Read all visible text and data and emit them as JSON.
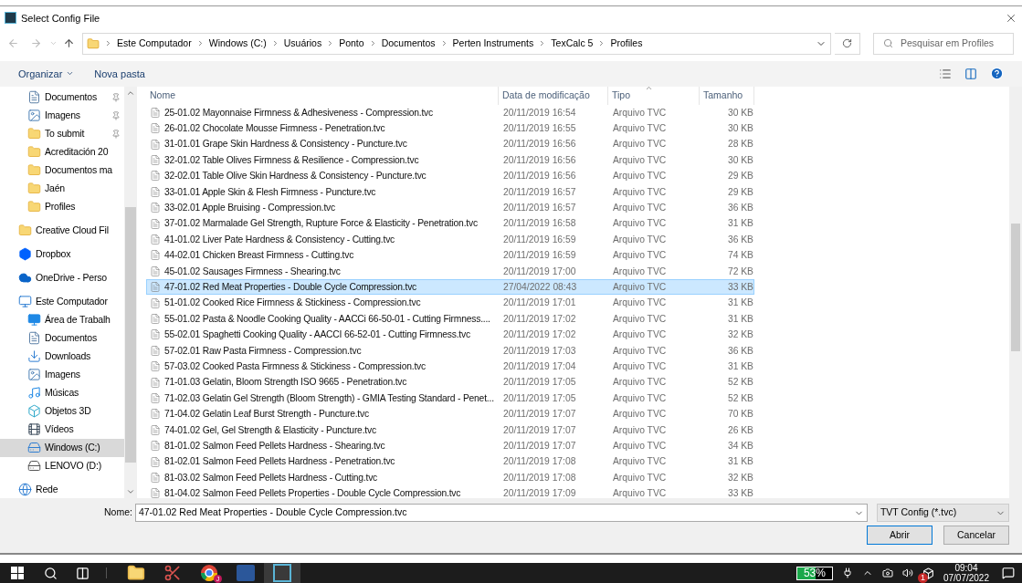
{
  "window": {
    "title": "Select Config File"
  },
  "breadcrumbs": [
    "Este Computador",
    "Windows (C:)",
    "Usuários",
    "Ponto",
    "Documentos",
    "Perten Instruments",
    "TexCalc 5",
    "Profiles"
  ],
  "search": {
    "placeholder": "Pesquisar em Profiles"
  },
  "toolbar": {
    "organize": "Organizar",
    "new_folder": "Nova pasta"
  },
  "sidebar": {
    "pinned_group": [
      {
        "label": "Documentos",
        "kind": "doc",
        "pinned": true,
        "selected": false
      },
      {
        "label": "Imagens",
        "kind": "image",
        "pinned": true,
        "selected": false
      },
      {
        "label": "To submit",
        "kind": "folder",
        "pinned": true,
        "selected": false
      },
      {
        "label": "Acreditación 20",
        "kind": "folder",
        "pinned": false,
        "selected": false
      },
      {
        "label": "Documentos ma",
        "kind": "folder",
        "pinned": false,
        "selected": false
      },
      {
        "label": "Jaén",
        "kind": "folder",
        "pinned": false,
        "selected": false
      },
      {
        "label": "Profiles",
        "kind": "folder",
        "pinned": false,
        "selected": false
      }
    ],
    "items": [
      {
        "label": "Creative Cloud Fil",
        "kind": "cc",
        "selected": false
      },
      {
        "label": "Dropbox",
        "kind": "dropbox",
        "selected": false
      },
      {
        "label": "OneDrive - Perso",
        "kind": "onedrive",
        "selected": false
      },
      {
        "label": "Este Computador",
        "kind": "computer",
        "selected": false,
        "children": [
          {
            "label": "Área de Trabalh",
            "kind": "desktop",
            "selected": false
          },
          {
            "label": "Documentos",
            "kind": "doc",
            "selected": false
          },
          {
            "label": "Downloads",
            "kind": "download",
            "selected": false
          },
          {
            "label": "Imagens",
            "kind": "image",
            "selected": false
          },
          {
            "label": "Músicas",
            "kind": "music",
            "selected": false
          },
          {
            "label": "Objetos 3D",
            "kind": "cube",
            "selected": false
          },
          {
            "label": "Vídeos",
            "kind": "video",
            "selected": false
          },
          {
            "label": "Windows (C:)",
            "kind": "windrive",
            "selected": true
          },
          {
            "label": "LENOVO (D:)",
            "kind": "drive",
            "selected": false
          }
        ]
      },
      {
        "label": "Rede",
        "kind": "network",
        "selected": false
      }
    ]
  },
  "table": {
    "columns": [
      "Nome",
      "Data de modificação",
      "Tipo",
      "Tamanho"
    ],
    "rows": [
      {
        "name": "25-01.02 Mayonnaise Firmness & Adhesiveness - Compression.tvc",
        "date": "20/11/2019 16:54",
        "type": "Arquivo TVC",
        "size": "30 KB",
        "selected": false
      },
      {
        "name": "26-01.02 Chocolate Mousse Firmness - Penetration.tvc",
        "date": "20/11/2019 16:55",
        "type": "Arquivo TVC",
        "size": "30 KB",
        "selected": false
      },
      {
        "name": "31-01.01 Grape Skin Hardness & Consistency - Puncture.tvc",
        "date": "20/11/2019 16:56",
        "type": "Arquivo TVC",
        "size": "28 KB",
        "selected": false
      },
      {
        "name": "32-01.02 Table Olives Firmness & Resilience - Compression.tvc",
        "date": "20/11/2019 16:56",
        "type": "Arquivo TVC",
        "size": "30 KB",
        "selected": false
      },
      {
        "name": "32-02.01 Table Olive Skin Hardness & Consistency - Puncture.tvc",
        "date": "20/11/2019 16:56",
        "type": "Arquivo TVC",
        "size": "29 KB",
        "selected": false
      },
      {
        "name": "33-01.01 Apple Skin & Flesh Firmness - Puncture.tvc",
        "date": "20/11/2019 16:57",
        "type": "Arquivo TVC",
        "size": "29 KB",
        "selected": false
      },
      {
        "name": "33-02.01 Apple Bruising - Compression.tvc",
        "date": "20/11/2019 16:57",
        "type": "Arquivo TVC",
        "size": "36 KB",
        "selected": false
      },
      {
        "name": "37-01.02 Marmalade Gel Strength, Rupture Force & Elasticity - Penetration.tvc",
        "date": "20/11/2019 16:58",
        "type": "Arquivo TVC",
        "size": "31 KB",
        "selected": false
      },
      {
        "name": "41-01.02 Liver Pate Hardness & Consistency - Cutting.tvc",
        "date": "20/11/2019 16:59",
        "type": "Arquivo TVC",
        "size": "36 KB",
        "selected": false
      },
      {
        "name": "44-02.01 Chicken Breast Firmness - Cutting.tvc",
        "date": "20/11/2019 16:59",
        "type": "Arquivo TVC",
        "size": "74 KB",
        "selected": false
      },
      {
        "name": "45-01.02 Sausages Firmness - Shearing.tvc",
        "date": "20/11/2019 17:00",
        "type": "Arquivo TVC",
        "size": "72 KB",
        "selected": false
      },
      {
        "name": "47-01.02 Red Meat Properties - Double Cycle Compression.tvc",
        "date": "27/04/2022 08:43",
        "type": "Arquivo TVC",
        "size": "33 KB",
        "selected": true
      },
      {
        "name": "51-01.02 Cooked Rice Firmness & Stickiness - Compression.tvc",
        "date": "20/11/2019 17:01",
        "type": "Arquivo TVC",
        "size": "31 KB",
        "selected": false
      },
      {
        "name": "55-01.02 Pasta & Noodle Cooking Quality - AACCi 66-50-01 - Cutting Firmness....",
        "date": "20/11/2019 17:02",
        "type": "Arquivo TVC",
        "size": "31 KB",
        "selected": false
      },
      {
        "name": "55-02.01 Spaghetti Cooking Quality - AACCI 66-52-01 - Cutting Firmness.tvc",
        "date": "20/11/2019 17:02",
        "type": "Arquivo TVC",
        "size": "32 KB",
        "selected": false
      },
      {
        "name": "57-02.01 Raw Pasta Firmness - Compression.tvc",
        "date": "20/11/2019 17:03",
        "type": "Arquivo TVC",
        "size": "36 KB",
        "selected": false
      },
      {
        "name": "57-03.02 Cooked Pasta Firmness & Stickiness - Compression.tvc",
        "date": "20/11/2019 17:04",
        "type": "Arquivo TVC",
        "size": "31 KB",
        "selected": false
      },
      {
        "name": "71-01.03 Gelatin, Bloom Strength ISO 9665 - Penetration.tvc",
        "date": "20/11/2019 17:05",
        "type": "Arquivo TVC",
        "size": "52 KB",
        "selected": false
      },
      {
        "name": "71-02.03 Gelatin Gel Strength (Bloom Strength) - GMIA Testing Standard - Penet...",
        "date": "20/11/2019 17:05",
        "type": "Arquivo TVC",
        "size": "52 KB",
        "selected": false
      },
      {
        "name": "71-04.02 Gelatin Leaf Burst Strength - Puncture.tvc",
        "date": "20/11/2019 17:07",
        "type": "Arquivo TVC",
        "size": "70 KB",
        "selected": false
      },
      {
        "name": "74-01.02 Gel, Gel Strength & Elasticity - Puncture.tvc",
        "date": "20/11/2019 17:07",
        "type": "Arquivo TVC",
        "size": "26 KB",
        "selected": false
      },
      {
        "name": "81-01.02 Salmon Feed Pellets Hardness - Shearing.tvc",
        "date": "20/11/2019 17:07",
        "type": "Arquivo TVC",
        "size": "34 KB",
        "selected": false
      },
      {
        "name": "81-02.01 Salmon Feed Pellets Hardness - Penetration.tvc",
        "date": "20/11/2019 17:08",
        "type": "Arquivo TVC",
        "size": "31 KB",
        "selected": false
      },
      {
        "name": "81-03.02 Salmon Feed Pellets Hardness - Cutting.tvc",
        "date": "20/11/2019 17:08",
        "type": "Arquivo TVC",
        "size": "32 KB",
        "selected": false
      },
      {
        "name": "81-04.02 Salmon Feed Pellets Properties - Double Cycle Compression.tvc",
        "date": "20/11/2019 17:09",
        "type": "Arquivo TVC",
        "size": "33 KB",
        "selected": false
      }
    ]
  },
  "footer": {
    "name_label": "Nome:",
    "name_value": "47-01.02 Red Meat Properties - Double Cycle Compression.tvc",
    "filter": "TVT Config (*.tvc)",
    "open": "Abrir",
    "cancel": "Cancelar"
  },
  "taskbar": {
    "apps": [
      {
        "kind": "explorer",
        "selected": false
      },
      {
        "kind": "snip",
        "selected": false
      },
      {
        "kind": "chrome",
        "badge": "J",
        "selected": false
      },
      {
        "kind": "word",
        "selected": false
      },
      {
        "kind": "texcalc",
        "selected": true
      }
    ],
    "battery": {
      "reading": "53%",
      "level": 0.53
    },
    "dropbox_badge": "1",
    "time": "09:04",
    "date": "07/07/2022"
  }
}
